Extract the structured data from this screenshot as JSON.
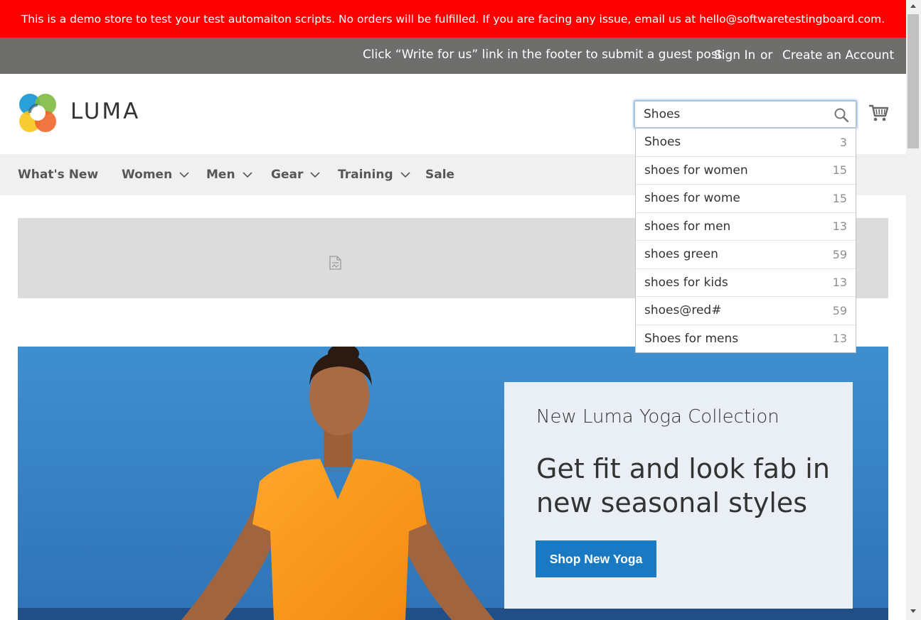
{
  "demo_notice": "This is a demo store to test your test automaiton scripts. No orders will be fulfilled. If you are facing any issue, email us at hello@softwaretestingboard.com.",
  "top_bar": {
    "guest_post": "Click “Write for us” link in the footer to submit a guest post",
    "sign_in": "Sign In",
    "or": "or",
    "create_account": "Create an Account"
  },
  "logo": {
    "text": "LUMA"
  },
  "search": {
    "value": "Shoes",
    "icon": "search-icon"
  },
  "cart": {
    "icon": "cart-icon"
  },
  "nav": {
    "items": [
      {
        "label": "What's New",
        "has_dropdown": false
      },
      {
        "label": "Women",
        "has_dropdown": true
      },
      {
        "label": "Men",
        "has_dropdown": true
      },
      {
        "label": "Gear",
        "has_dropdown": true
      },
      {
        "label": "Training",
        "has_dropdown": true
      },
      {
        "label": "Sale",
        "has_dropdown": false
      }
    ]
  },
  "autocomplete": {
    "suggestions": [
      {
        "term": "Shoes",
        "count": "3"
      },
      {
        "term": "shoes for women",
        "count": "15"
      },
      {
        "term": "shoes for wome",
        "count": "15"
      },
      {
        "term": "shoes for men",
        "count": "13"
      },
      {
        "term": "shoes green",
        "count": "59"
      },
      {
        "term": "shoes for kids",
        "count": "13"
      },
      {
        "term": "shoes@red#",
        "count": "59"
      },
      {
        "term": "Shoes for mens",
        "count": "13"
      }
    ]
  },
  "hero": {
    "subtitle": "New Luma Yoga Collection",
    "title": "Get fit and look fab in new seasonal styles",
    "button": "Shop New Yoga"
  },
  "colors": {
    "notice_red": "#ff0000",
    "top_bar_grey": "#6e6e6c",
    "nav_bg": "#f0f0f0",
    "button_blue": "#1979c3",
    "hero_panel": "#eaeff5"
  }
}
